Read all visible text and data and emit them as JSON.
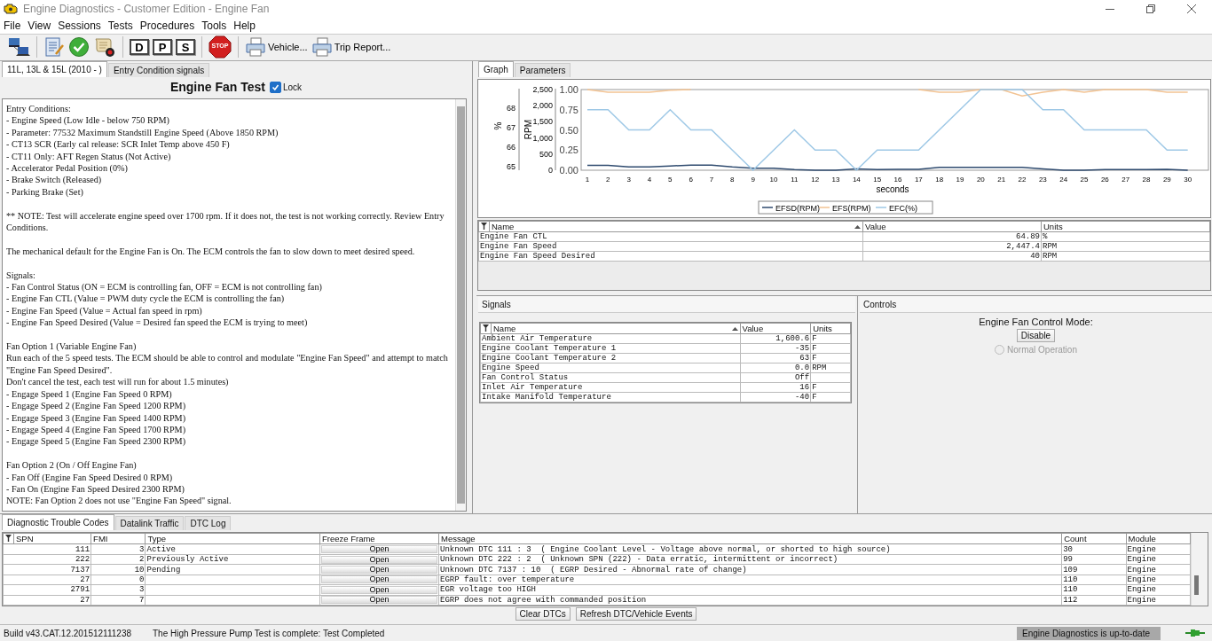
{
  "window": {
    "title": "Engine Diagnostics - Customer Edition - Engine Fan"
  },
  "menu": [
    "File",
    "View",
    "Sessions",
    "Tests",
    "Procedures",
    "Tools",
    "Help"
  ],
  "toolbar": {
    "letter_buttons": [
      "D",
      "P",
      "S"
    ],
    "stop_label": "STOP",
    "print_buttons": [
      "Vehicle...",
      "Trip Report..."
    ]
  },
  "left_panel": {
    "tabs": [
      {
        "label": "11L, 13L & 15L (2010 - )",
        "selected": true
      },
      {
        "label": "Entry Condition signals",
        "selected": false
      }
    ],
    "test_title": "Engine Fan Test",
    "lock": {
      "label": "Lock",
      "checked": true
    },
    "instructions": [
      [
        "Entry Conditions:",
        "- Engine Speed (Low Idle - below 750 RPM)",
        "- Parameter: 77532 Maximum Standstill Engine Speed (Above 1850 RPM)",
        "- CT13 SCR (Early cal release: SCR Inlet Temp above 450 F)",
        "- CT11 Only: AFT Regen Status (Not Active)",
        "- Accelerator Pedal Position (0%)",
        "- Brake Switch (Released)",
        "- Parking Brake (Set)"
      ],
      [
        "** NOTE: Test will accelerate engine speed over 1700 rpm. If it does not, the test is not working correctly. Review Entry Conditions."
      ],
      [
        "The mechanical default for the Engine Fan is On. The ECM controls the fan to slow down to meet desired speed."
      ],
      [
        "Signals:",
        "- Fan Control Status (ON = ECM is controlling fan, OFF = ECM is not controlling fan)",
        "- Engine Fan CTL (Value = PWM duty cycle the ECM is controlling the fan)",
        "- Engine Fan Speed (Value = Actual fan speed in rpm)",
        "- Engine Fan Speed Desired (Value = Desired fan speed the ECM is trying to meet)"
      ],
      [
        "Fan Option 1 (Variable Engine Fan)",
        "Run each of the 5 speed tests. The ECM should be able to control and modulate \"Engine Fan Speed\" and attempt to match \"Engine Fan Speed Desired\".",
        "Don't cancel the test, each test will run for about 1.5 minutes)",
        "- Engage Speed 1 (Engine Fan Speed 0 RPM)",
        "- Engage Speed 2 (Engine Fan Speed 1200 RPM)",
        "- Engage Speed 3 (Engine Fan Speed 1400 RPM)",
        "- Engage Speed 4 (Engine Fan Speed 1700 RPM)",
        "- Engage Speed 5 (Engine Fan Speed 2300 RPM)"
      ],
      [
        "Fan Option 2 (On / Off Engine Fan)",
        "- Fan Off (Engine Fan Speed Desired 0 RPM)",
        "- Fan On (Engine Fan Speed Desired 2300 RPM)",
        "NOTE: Fan Option 2 does not use \"Engine Fan Speed\" signal."
      ]
    ]
  },
  "graph_panel": {
    "tabs": [
      {
        "label": "Graph",
        "selected": true
      },
      {
        "label": "Parameters",
        "selected": false
      }
    ],
    "percent_axis": {
      "label": "%",
      "ticks": [
        "68",
        "67",
        "66",
        "65"
      ]
    },
    "chart_data": {
      "type": "line",
      "xlabel": "seconds",
      "ylabel": "RPM",
      "x": [
        1,
        2,
        3,
        4,
        5,
        6,
        7,
        8,
        9,
        10,
        11,
        12,
        13,
        14,
        15,
        16,
        17,
        18,
        19,
        20,
        21,
        22,
        23,
        24,
        25,
        26,
        27,
        28,
        29,
        30
      ],
      "xticks": [
        1,
        2,
        3,
        4,
        5,
        6,
        7,
        8,
        9,
        10,
        11,
        12,
        13,
        14,
        15,
        16,
        17,
        18,
        19,
        20,
        21,
        22,
        23,
        24,
        25,
        26,
        27,
        28,
        29,
        30
      ],
      "xlim": [
        0.7,
        31
      ],
      "ylim": [
        0,
        2500
      ],
      "legend": "bottom",
      "y2lim": [
        0,
        1
      ],
      "y2ticks": [
        {
          "value": 0,
          "label": "0.00"
        },
        {
          "value": 0.25,
          "label": "0.25"
        },
        {
          "value": 0.5,
          "label": "0.50"
        },
        {
          "value": 0.75,
          "label": "0.75"
        },
        {
          "value": 1,
          "label": "1.00"
        }
      ],
      "yticks": [
        {
          "value": 0,
          "label": "0"
        },
        {
          "value": 500,
          "label": "500"
        },
        {
          "value": 1000,
          "label": "1,000"
        },
        {
          "value": 1500,
          "label": "1,500"
        },
        {
          "value": 2000,
          "label": "2,000"
        },
        {
          "value": 2500,
          "label": "2,500"
        }
      ],
      "series": [
        {
          "name": "EFSD(RPM)",
          "color": "#2e4a6e",
          "values": [
            150,
            150,
            100,
            100,
            130,
            160,
            160,
            100,
            60,
            60,
            20,
            0,
            0,
            40,
            20,
            30,
            30,
            90,
            90,
            90,
            90,
            90,
            40,
            0,
            0,
            20,
            20,
            20,
            30,
            0
          ]
        },
        {
          "name": "EFS(RPM)",
          "color": "#f2c393",
          "values": [
            2500,
            2420,
            2420,
            2420,
            2480,
            2500,
            null,
            null,
            null,
            null,
            null,
            null,
            null,
            null,
            null,
            null,
            2500,
            2420,
            2420,
            2500,
            2500,
            2300,
            2420,
            2500,
            2420,
            2500,
            2500,
            2500,
            2420,
            2420
          ]
        },
        {
          "name": "EFC(%)",
          "color": "#9ec8e6",
          "axis": "y2",
          "values": [
            0.75,
            0.75,
            0.5,
            0.5,
            0.75,
            0.5,
            0.5,
            0.25,
            0,
            0.25,
            0.5,
            0.25,
            0.25,
            0,
            0.25,
            0.25,
            0.25,
            0.5,
            0.75,
            1,
            1,
            1,
            0.75,
            0.75,
            0.5,
            0.5,
            0.5,
            0.5,
            0.25,
            0.25
          ]
        }
      ]
    },
    "table": {
      "columns": [
        "Name",
        "Value",
        "Units"
      ],
      "rows": [
        [
          "Engine Fan CTL",
          "64.89",
          "%"
        ],
        [
          "Engine Fan Speed",
          "2,447.4",
          "RPM"
        ],
        [
          "Engine Fan Speed Desired",
          "40",
          "RPM"
        ]
      ]
    }
  },
  "signals_panel": {
    "title": "Signals",
    "table": {
      "columns": [
        "Name",
        "Value",
        "Units"
      ],
      "rows": [
        [
          "Ambient Air Temperature",
          "1,600.6",
          "F"
        ],
        [
          "Engine Coolant Temperature 1",
          "-35",
          "F"
        ],
        [
          "Engine Coolant Temperature 2",
          "63",
          "F"
        ],
        [
          "Engine Speed",
          "0.0",
          "RPM"
        ],
        [
          "Fan Control Status",
          "Off",
          ""
        ],
        [
          "Inlet Air Temperature",
          "16",
          "F"
        ],
        [
          "Intake Manifold Temperature",
          "-40",
          "F"
        ]
      ]
    }
  },
  "controls_panel": {
    "title": "Controls",
    "mode_label": "Engine Fan Control Mode:",
    "button": "Disable",
    "radio": {
      "label": "Normal Operation",
      "selected": false,
      "disabled": true
    }
  },
  "dtc_panel": {
    "tabs": [
      {
        "label": "Diagnostic Trouble Codes",
        "selected": true
      },
      {
        "label": "Datalink Traffic",
        "selected": false
      },
      {
        "label": "DTC Log",
        "selected": false
      }
    ],
    "columns": [
      "SPN",
      "FMI",
      "Type",
      "Freeze Frame",
      "Message",
      "Count",
      "Module"
    ],
    "rows": [
      {
        "spn": "111",
        "fmi": "3",
        "type": "Active",
        "freeze_frame": "Open",
        "message": "Unknown DTC 111 : 3  ( Engine Coolant Level - Voltage above normal, or shorted to high source)",
        "count": "30",
        "module": "Engine"
      },
      {
        "spn": "222",
        "fmi": "2",
        "type": "Previously Active",
        "freeze_frame": "Open",
        "message": "Unknown DTC 222 : 2  ( Unknown SPN (222) - Data erratic, intermittent or incorrect)",
        "count": "99",
        "module": "Engine"
      },
      {
        "spn": "7137",
        "fmi": "10",
        "type": "Pending",
        "freeze_frame": "Open",
        "message": "Unknown DTC 7137 : 10  ( EGRP Desired - Abnormal rate of change)",
        "count": "109",
        "module": "Engine"
      },
      {
        "spn": "27",
        "fmi": "0",
        "freeze_frame": "Open",
        "message": "EGRP fault: over temperature",
        "count": "110",
        "module": "Engine"
      },
      {
        "spn": "2791",
        "fmi": "3",
        "freeze_frame": "Open",
        "message": "EGR voltage too HIGH",
        "count": "110",
        "module": "Engine"
      },
      {
        "spn": "27",
        "fmi": "7",
        "freeze_frame": "Open",
        "message": "EGRP does not agree with commanded position",
        "count": "112",
        "module": "Engine"
      }
    ],
    "buttons": [
      "Clear DTCs",
      "Refresh DTC/Vehicle Events"
    ]
  },
  "status_bar": {
    "build": "Build v43.CAT.12.201512111238",
    "message": "The High Pressure Pump Test is complete: Test Completed",
    "update_status": "Engine Diagnostics is up-to-date"
  }
}
